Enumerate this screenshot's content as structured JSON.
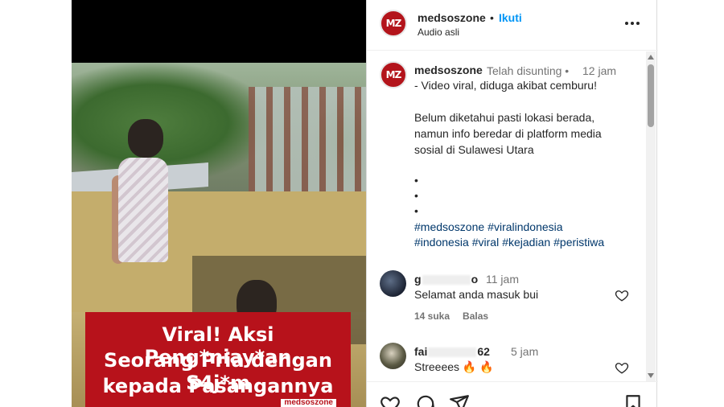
{
  "video": {
    "caption_lines": [
      "Viral! Aksi Peng*niay*an",
      "Seorang Pria dengan S4j*m",
      "kepada Pasangannya"
    ],
    "watermark": "medsoszone"
  },
  "header": {
    "avatar_text": "MZ",
    "username": "medsoszone",
    "separator": "•",
    "follow_label": "Ikuti",
    "subtitle": "Audio asli"
  },
  "caption": {
    "avatar_text": "MZ",
    "username": "medsoszone",
    "edited": "Telah disunting •",
    "time": "12 jam",
    "lines": [
      "- Video viral, diduga akibat cemburu!",
      "Belum diketahui pasti lokasi berada,",
      "namun info beredar di platform media",
      "sosial di Sulawesi Utara",
      "•",
      "•",
      "•"
    ],
    "hashtags_line1": [
      "#medsoszone",
      "#viralindonesia"
    ],
    "hashtags_line2": [
      "#indonesia",
      "#viral",
      "#kejadian",
      "#peristiwa"
    ]
  },
  "comments": [
    {
      "user_start": "g",
      "user_end": "o",
      "time": "11 jam",
      "text": "Selamat anda masuk bui",
      "likes": "14 suka",
      "reply": "Balas"
    },
    {
      "user_start": "fai",
      "user_end": "62",
      "time": "5 jam",
      "text": "Streeees 🔥 🔥"
    }
  ],
  "colors": {
    "accent": "#0095f6",
    "brand_red": "#b3141b",
    "hashtag": "#00376b",
    "muted": "#737373"
  },
  "icons": [
    "more-icon",
    "heart-icon",
    "comment-icon",
    "share-icon",
    "bookmark-icon"
  ]
}
